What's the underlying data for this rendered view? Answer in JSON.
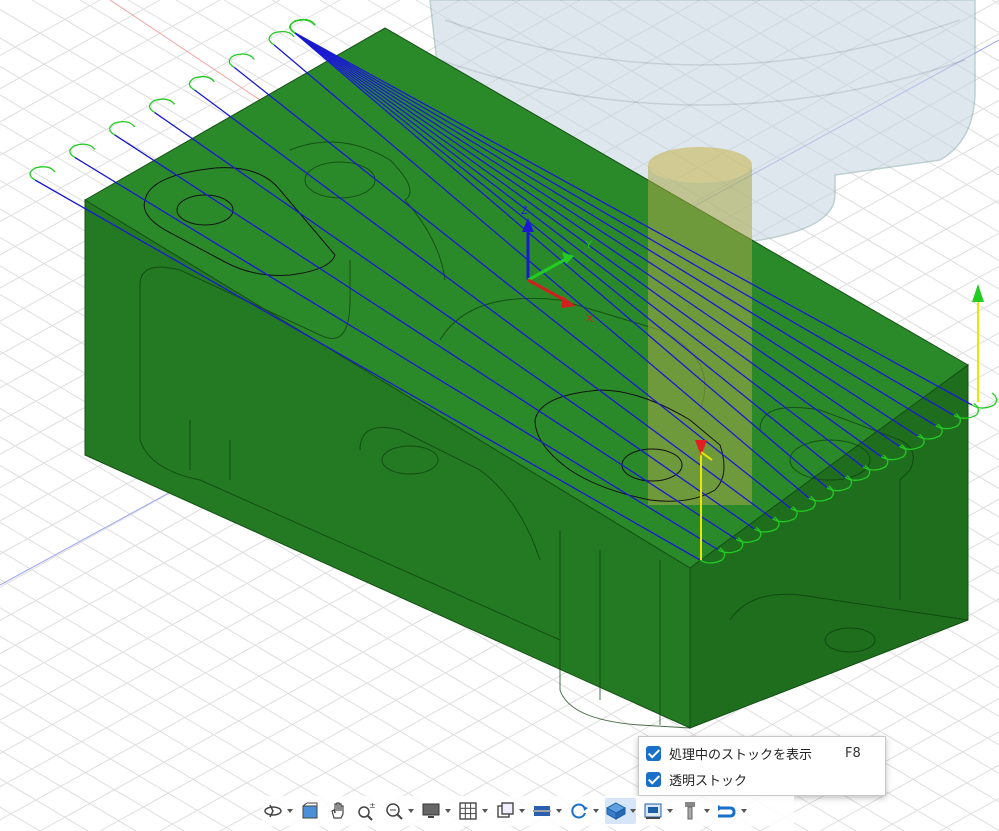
{
  "viewport": {
    "axis_labels": {
      "z": "Z",
      "y": "Y",
      "x": "X"
    },
    "colors": {
      "stock": "#1f7a1f",
      "toolpath": "#1a1ad0",
      "link": "#22cc22",
      "tool": "#b0c8d8",
      "grid": "#dcdcdc"
    }
  },
  "menu": {
    "items": [
      {
        "label": "処理中のストックを表示",
        "shortcut": "F8",
        "checked": true
      },
      {
        "label": "透明ストック",
        "shortcut": "",
        "checked": true
      }
    ]
  },
  "toolbar": {
    "buttons": [
      {
        "icon": "orbit-icon",
        "dropdown": true
      },
      {
        "icon": "look-at-icon",
        "dropdown": false
      },
      {
        "icon": "pan-icon",
        "dropdown": false
      },
      {
        "icon": "zoom-icon",
        "dropdown": false
      },
      {
        "icon": "fit-icon",
        "dropdown": true
      },
      {
        "icon": "display-settings-icon",
        "dropdown": true
      },
      {
        "icon": "grid-icon",
        "dropdown": true
      },
      {
        "icon": "viewports-icon",
        "dropdown": true
      },
      {
        "icon": "section-icon",
        "dropdown": true
      },
      {
        "icon": "simulation-icon",
        "dropdown": true
      },
      {
        "icon": "stock-display-icon",
        "dropdown": true
      },
      {
        "icon": "machine-icon",
        "dropdown": true
      },
      {
        "icon": "tool-display-icon",
        "dropdown": true
      },
      {
        "icon": "toolpath-display-icon",
        "dropdown": true
      }
    ]
  }
}
